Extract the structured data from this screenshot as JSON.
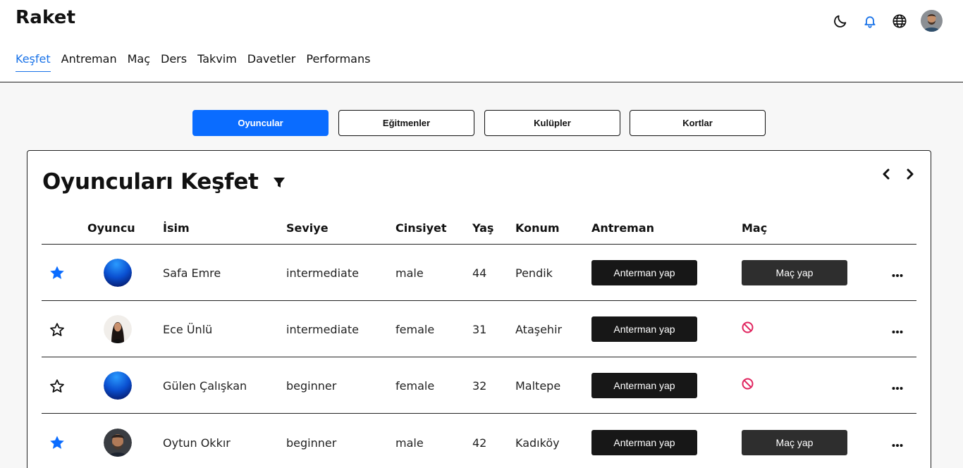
{
  "app": {
    "brand": "Raket"
  },
  "nav": [
    "Keşfet",
    "Antreman",
    "Maç",
    "Ders",
    "Takvim",
    "Davetler",
    "Performans"
  ],
  "tabs": [
    "Oyuncular",
    "Eğitmenler",
    "Kulüpler",
    "Kortlar"
  ],
  "card": {
    "title": "Oyuncuları Keşfet"
  },
  "table": {
    "headers": [
      "Oyuncu",
      "İsim",
      "Seviye",
      "Cinsiyet",
      "Yaş",
      "Konum",
      "Antreman",
      "Maç"
    ],
    "rows": [
      {
        "name": "Safa Emre",
        "level": "intermediate",
        "gender": "male",
        "age": "44",
        "location": "Pendik",
        "train": "Anterman yap",
        "match": "Maç yap",
        "favorite": true,
        "match_available": true,
        "avatar": "gradient"
      },
      {
        "name": "Ece Ünlü",
        "level": "intermediate",
        "gender": "female",
        "age": "31",
        "location": "Ataşehir",
        "train": "Anterman yap",
        "match": "",
        "favorite": false,
        "match_available": false,
        "avatar": "photo-woman"
      },
      {
        "name": "Gülen Çalışkan",
        "level": "beginner",
        "gender": "female",
        "age": "32",
        "location": "Maltepe",
        "train": "Anterman yap",
        "match": "",
        "favorite": false,
        "match_available": false,
        "avatar": "gradient"
      },
      {
        "name": "Oytun Okkır",
        "level": "beginner",
        "gender": "male",
        "age": "42",
        "location": "Kadıköy",
        "train": "Anterman yap",
        "match": "Maç yap",
        "favorite": true,
        "match_available": true,
        "avatar": "photo-man"
      }
    ]
  },
  "colors": {
    "accent": "#0a6cff",
    "link": "#1a73e8",
    "ban": "#e0245e"
  },
  "icons": [
    "moon-icon",
    "bell-icon",
    "globe-icon",
    "filter-icon",
    "chevron-left-icon",
    "chevron-right-icon",
    "star-icon",
    "ban-icon",
    "more-icon"
  ]
}
